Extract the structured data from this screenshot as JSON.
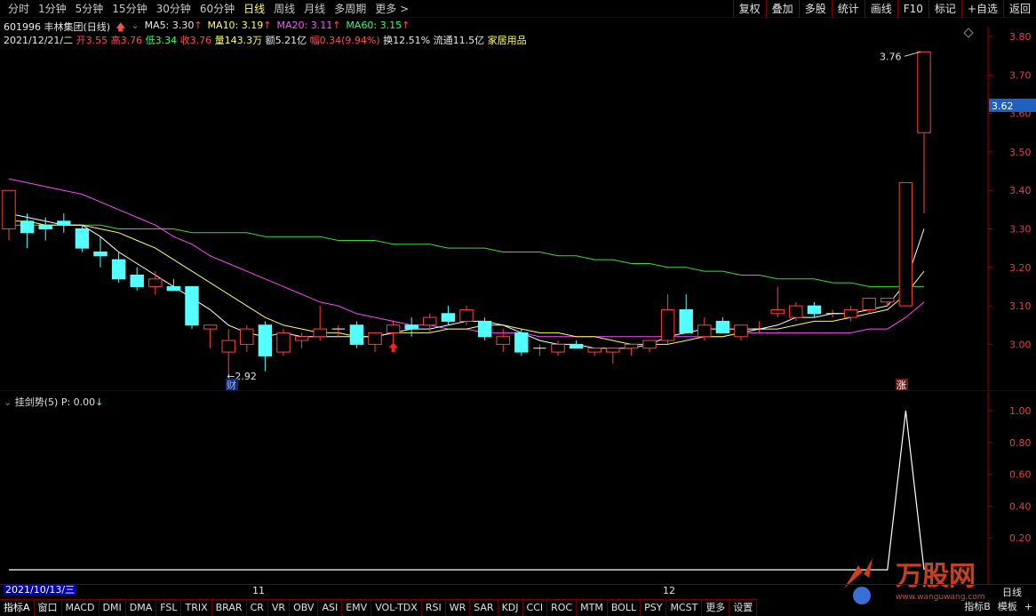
{
  "period_tabs": [
    "分时",
    "1分钟",
    "5分钟",
    "15分钟",
    "30分钟",
    "60分钟",
    "日线",
    "周线",
    "月线",
    "多周期",
    "更多 >"
  ],
  "active_period": "日线",
  "right_tools": [
    "复权",
    "叠加",
    "多股",
    "统计",
    "画线",
    "F10",
    "标记",
    "+自选",
    "返回"
  ],
  "stock": {
    "code_name": "601996 丰林集团(日线)"
  },
  "ma": {
    "ma5": "MA5: 3.30",
    "ma10": "MA10: 3.19",
    "ma20": "MA20: 3.11",
    "ma60": "MA60: 3.15"
  },
  "bar": {
    "date": "2021/12/21/二",
    "open_label": "开",
    "open": "3.55",
    "high_label": "高",
    "high": "3.76",
    "low_label": "低",
    "low": "3.34",
    "close_label": "收",
    "close": "3.76",
    "vol_label": "量",
    "vol": "143.3万",
    "amt_label": "额",
    "amt": "5.21亿",
    "chg_label": "幅",
    "chg": "0.34(9.94%)",
    "turn_label": "换",
    "turn": "12.51%",
    "float_label": "流通",
    "float": "11.5亿",
    "sector": "家居用品"
  },
  "price_axis": [
    "3.80",
    "3.70",
    "3.60",
    "3.50",
    "3.40",
    "3.30",
    "3.20",
    "3.10",
    "3.00"
  ],
  "current_price": "3.62",
  "annotations": {
    "high": "3.76",
    "low": "2.92",
    "cai": "财",
    "zhang": "涨"
  },
  "indicator": {
    "name": "挂剑势(5)",
    "value": "P: 0.00"
  },
  "indicator_axis": [
    "1.00",
    "0.80",
    "0.60",
    "0.40",
    "0.20"
  ],
  "dates": {
    "start": "2021/10/13/三",
    "m11": "11",
    "m12": "12",
    "period": "日线"
  },
  "bottom_tabs": [
    "指标A",
    "窗口",
    "MACD",
    "DMI",
    "DMA",
    "FSL",
    "TRIX",
    "BRAR",
    "CR",
    "VR",
    "OBV",
    "ASI",
    "EMV",
    "VOL-TDX",
    "RSI",
    "WR",
    "SAR",
    "KDJ",
    "CCI",
    "ROC",
    "MTM",
    "BOLL",
    "PSY",
    "MCST",
    "更多",
    "设置"
  ],
  "bottom_right": [
    "指标B",
    "模板",
    "+"
  ],
  "watermark": {
    "text": "万股网",
    "url": "www.wanguwang.com"
  },
  "colors": {
    "up": "#ff4040",
    "down": "#54ffff",
    "ma5": "#ffffff",
    "ma10": "#ffff55",
    "ma20": "#ff44ff",
    "ma60": "#33dd33",
    "axis": "#a00000"
  },
  "candles": [
    {
      "o": 3.3,
      "h": 3.4,
      "l": 3.27,
      "c": 3.4
    },
    {
      "o": 3.32,
      "h": 3.34,
      "l": 3.25,
      "c": 3.29
    },
    {
      "o": 3.31,
      "h": 3.33,
      "l": 3.27,
      "c": 3.3
    },
    {
      "o": 3.32,
      "h": 3.34,
      "l": 3.29,
      "c": 3.31
    },
    {
      "o": 3.3,
      "h": 3.31,
      "l": 3.24,
      "c": 3.25
    },
    {
      "o": 3.24,
      "h": 3.28,
      "l": 3.2,
      "c": 3.23
    },
    {
      "o": 3.22,
      "h": 3.24,
      "l": 3.16,
      "c": 3.17
    },
    {
      "o": 3.18,
      "h": 3.2,
      "l": 3.14,
      "c": 3.15
    },
    {
      "o": 3.15,
      "h": 3.19,
      "l": 3.13,
      "c": 3.17
    },
    {
      "o": 3.15,
      "h": 3.17,
      "l": 3.14,
      "c": 3.14
    },
    {
      "o": 3.15,
      "h": 3.15,
      "l": 3.04,
      "c": 3.05
    },
    {
      "o": 3.04,
      "h": 3.05,
      "l": 2.99,
      "c": 3.05
    },
    {
      "o": 2.98,
      "h": 3.04,
      "l": 2.92,
      "c": 3.01
    },
    {
      "o": 3.0,
      "h": 3.05,
      "l": 2.98,
      "c": 3.04
    },
    {
      "o": 3.05,
      "h": 3.06,
      "l": 2.93,
      "c": 2.97
    },
    {
      "o": 2.98,
      "h": 3.04,
      "l": 2.97,
      "c": 3.03
    },
    {
      "o": 3.01,
      "h": 3.03,
      "l": 2.99,
      "c": 3.02
    },
    {
      "o": 3.02,
      "h": 3.1,
      "l": 3.01,
      "c": 3.04
    },
    {
      "o": 3.04,
      "h": 3.05,
      "l": 3.02,
      "c": 3.04
    },
    {
      "o": 3.05,
      "h": 3.06,
      "l": 2.99,
      "c": 3.0
    },
    {
      "o": 3.0,
      "h": 3.03,
      "l": 2.98,
      "c": 3.03
    },
    {
      "o": 3.03,
      "h": 3.06,
      "l": 3.0,
      "c": 3.05
    },
    {
      "o": 3.05,
      "h": 3.07,
      "l": 3.02,
      "c": 3.04
    },
    {
      "o": 3.05,
      "h": 3.08,
      "l": 3.03,
      "c": 3.07
    },
    {
      "o": 3.08,
      "h": 3.1,
      "l": 3.05,
      "c": 3.06
    },
    {
      "o": 3.06,
      "h": 3.1,
      "l": 3.05,
      "c": 3.09
    },
    {
      "o": 3.06,
      "h": 3.07,
      "l": 3.01,
      "c": 3.02
    },
    {
      "o": 3.0,
      "h": 3.04,
      "l": 2.98,
      "c": 3.02
    },
    {
      "o": 3.03,
      "h": 3.04,
      "l": 2.97,
      "c": 2.98
    },
    {
      "o": 2.99,
      "h": 3.0,
      "l": 2.97,
      "c": 2.99
    },
    {
      "o": 2.98,
      "h": 3.01,
      "l": 2.97,
      "c": 3.0
    },
    {
      "o": 3.0,
      "h": 3.01,
      "l": 2.99,
      "c": 2.99
    },
    {
      "o": 2.98,
      "h": 2.99,
      "l": 2.97,
      "c": 2.99
    },
    {
      "o": 2.98,
      "h": 2.99,
      "l": 2.95,
      "c": 2.99
    },
    {
      "o": 2.99,
      "h": 3.0,
      "l": 2.97,
      "c": 3.0
    },
    {
      "o": 2.99,
      "h": 3.01,
      "l": 2.98,
      "c": 3.01
    },
    {
      "o": 3.01,
      "h": 3.13,
      "l": 3.0,
      "c": 3.09
    },
    {
      "o": 3.09,
      "h": 3.13,
      "l": 3.03,
      "c": 3.03
    },
    {
      "o": 3.02,
      "h": 3.07,
      "l": 3.01,
      "c": 3.05
    },
    {
      "o": 3.06,
      "h": 3.07,
      "l": 3.03,
      "c": 3.03
    },
    {
      "o": 3.02,
      "h": 3.05,
      "l": 3.01,
      "c": 3.05
    },
    {
      "o": 3.04,
      "h": 3.06,
      "l": 3.03,
      "c": 3.04
    },
    {
      "o": 3.08,
      "h": 3.15,
      "l": 3.07,
      "c": 3.09
    },
    {
      "o": 3.07,
      "h": 3.11,
      "l": 3.06,
      "c": 3.1
    },
    {
      "o": 3.1,
      "h": 3.11,
      "l": 3.07,
      "c": 3.08
    },
    {
      "o": 3.08,
      "h": 3.09,
      "l": 3.07,
      "c": 3.08
    },
    {
      "o": 3.07,
      "h": 3.1,
      "l": 3.06,
      "c": 3.09
    },
    {
      "o": 3.09,
      "h": 3.12,
      "l": 3.08,
      "c": 3.12
    },
    {
      "o": 3.11,
      "h": 3.12,
      "l": 3.1,
      "c": 3.12
    },
    {
      "o": 3.1,
      "h": 3.42,
      "l": 3.1,
      "c": 3.42
    },
    {
      "o": 3.55,
      "h": 3.76,
      "l": 3.34,
      "c": 3.76
    }
  ],
  "ma_series": {
    "ma5": [
      3.34,
      3.33,
      3.32,
      3.31,
      3.31,
      3.28,
      3.24,
      3.21,
      3.18,
      3.15,
      3.12,
      3.09,
      3.05,
      3.03,
      3.02,
      3.03,
      3.02,
      3.02,
      3.02,
      3.02,
      3.02,
      3.03,
      3.04,
      3.04,
      3.05,
      3.06,
      3.06,
      3.05,
      3.03,
      3.01,
      3.0,
      3.0,
      2.99,
      2.99,
      2.99,
      3.0,
      3.02,
      3.03,
      3.04,
      3.04,
      3.04,
      3.04,
      3.05,
      3.07,
      3.07,
      3.08,
      3.08,
      3.09,
      3.1,
      3.16,
      3.3
    ],
    "ma10": [
      3.32,
      3.32,
      3.31,
      3.31,
      3.31,
      3.3,
      3.29,
      3.27,
      3.25,
      3.22,
      3.19,
      3.16,
      3.13,
      3.1,
      3.07,
      3.05,
      3.04,
      3.03,
      3.03,
      3.02,
      3.02,
      3.03,
      3.03,
      3.03,
      3.04,
      3.04,
      3.05,
      3.05,
      3.04,
      3.03,
      3.03,
      3.02,
      3.02,
      3.01,
      3.0,
      3.0,
      3.0,
      3.01,
      3.02,
      3.02,
      3.03,
      3.04,
      3.04,
      3.05,
      3.06,
      3.06,
      3.07,
      3.08,
      3.09,
      3.13,
      3.19
    ],
    "ma20": [
      3.43,
      3.42,
      3.41,
      3.4,
      3.39,
      3.37,
      3.35,
      3.33,
      3.31,
      3.28,
      3.26,
      3.23,
      3.21,
      3.19,
      3.17,
      3.15,
      3.13,
      3.11,
      3.1,
      3.08,
      3.07,
      3.06,
      3.05,
      3.05,
      3.04,
      3.04,
      3.03,
      3.03,
      3.03,
      3.02,
      3.02,
      3.02,
      3.02,
      3.02,
      3.02,
      3.02,
      3.02,
      3.02,
      3.02,
      3.02,
      3.03,
      3.03,
      3.03,
      3.03,
      3.03,
      3.03,
      3.03,
      3.04,
      3.04,
      3.07,
      3.11
    ],
    "ma60": [
      3.31,
      3.31,
      3.31,
      3.31,
      3.31,
      3.31,
      3.3,
      3.3,
      3.3,
      3.3,
      3.29,
      3.29,
      3.29,
      3.29,
      3.28,
      3.28,
      3.28,
      3.28,
      3.27,
      3.27,
      3.27,
      3.26,
      3.26,
      3.26,
      3.25,
      3.25,
      3.25,
      3.24,
      3.24,
      3.24,
      3.23,
      3.23,
      3.22,
      3.22,
      3.21,
      3.21,
      3.2,
      3.2,
      3.19,
      3.19,
      3.18,
      3.18,
      3.17,
      3.17,
      3.17,
      3.16,
      3.16,
      3.15,
      3.15,
      3.15,
      3.15
    ]
  },
  "indicator_series": [
    0,
    0,
    0,
    0,
    0,
    0,
    0,
    0,
    0,
    0,
    0,
    0,
    0,
    0,
    0,
    0,
    0,
    0,
    0,
    0,
    0,
    0,
    0,
    0,
    0,
    0,
    0,
    0,
    0,
    0,
    0,
    0,
    0,
    0,
    0,
    0,
    0,
    0,
    0,
    0,
    0,
    0,
    0,
    0,
    0,
    0,
    0,
    0,
    0,
    1.0,
    0
  ]
}
